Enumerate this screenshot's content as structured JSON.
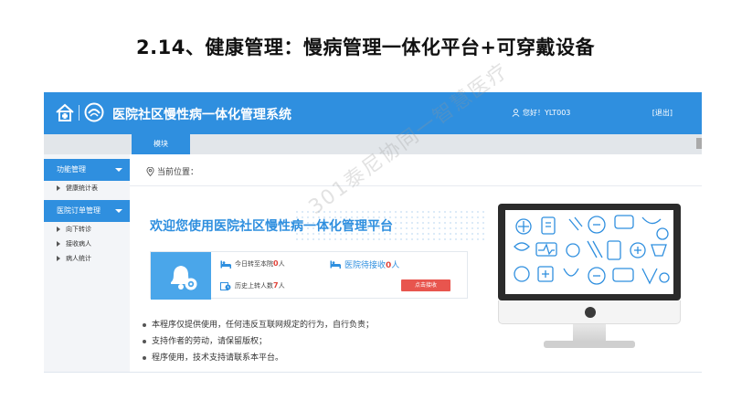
{
  "slide": {
    "title": "2.14、健康管理：慢病管理一体化平台+可穿戴设备"
  },
  "header": {
    "app_title": "医院社区慢性病一体化管理系统",
    "greeting": "您好！YLT003",
    "logout_label": "[退出]"
  },
  "tabs": {
    "active_label": "模块"
  },
  "sidebar": {
    "groups": [
      {
        "label": "功能管理",
        "items": [
          {
            "label": "健康统计表"
          }
        ]
      },
      {
        "label": "医院订单管理",
        "items": [
          {
            "label": "向下转诊"
          },
          {
            "label": "接收病人"
          },
          {
            "label": "病人统计"
          }
        ]
      }
    ]
  },
  "main": {
    "breadcrumb": "当前位置：",
    "welcome": "欢迎您使用医院社区慢性病一体化管理平台",
    "stats": {
      "today_prefix": "今日转至本院",
      "today_value": "0",
      "today_unit": "人",
      "waiting_prefix": "医院待接收",
      "waiting_value": "0",
      "waiting_unit": "人",
      "history_prefix": "历史上转人数",
      "history_value": "7",
      "history_unit": "人",
      "accept_button": "点击接收"
    },
    "notes": [
      "本程序仅提供使用，任何违反互联网规定的行为，自行负责；",
      "支持作者的劳动，请保留版权；",
      "程序使用，技术支持请联系本平台。"
    ]
  },
  "watermark": "301泰尼协同一智慧医疗",
  "colors": {
    "primary": "#2f8fdf",
    "accent_red": "#e8554e",
    "sidebar_bg": "#f3f5f8",
    "tabbar_bg": "#e2e6ea"
  }
}
